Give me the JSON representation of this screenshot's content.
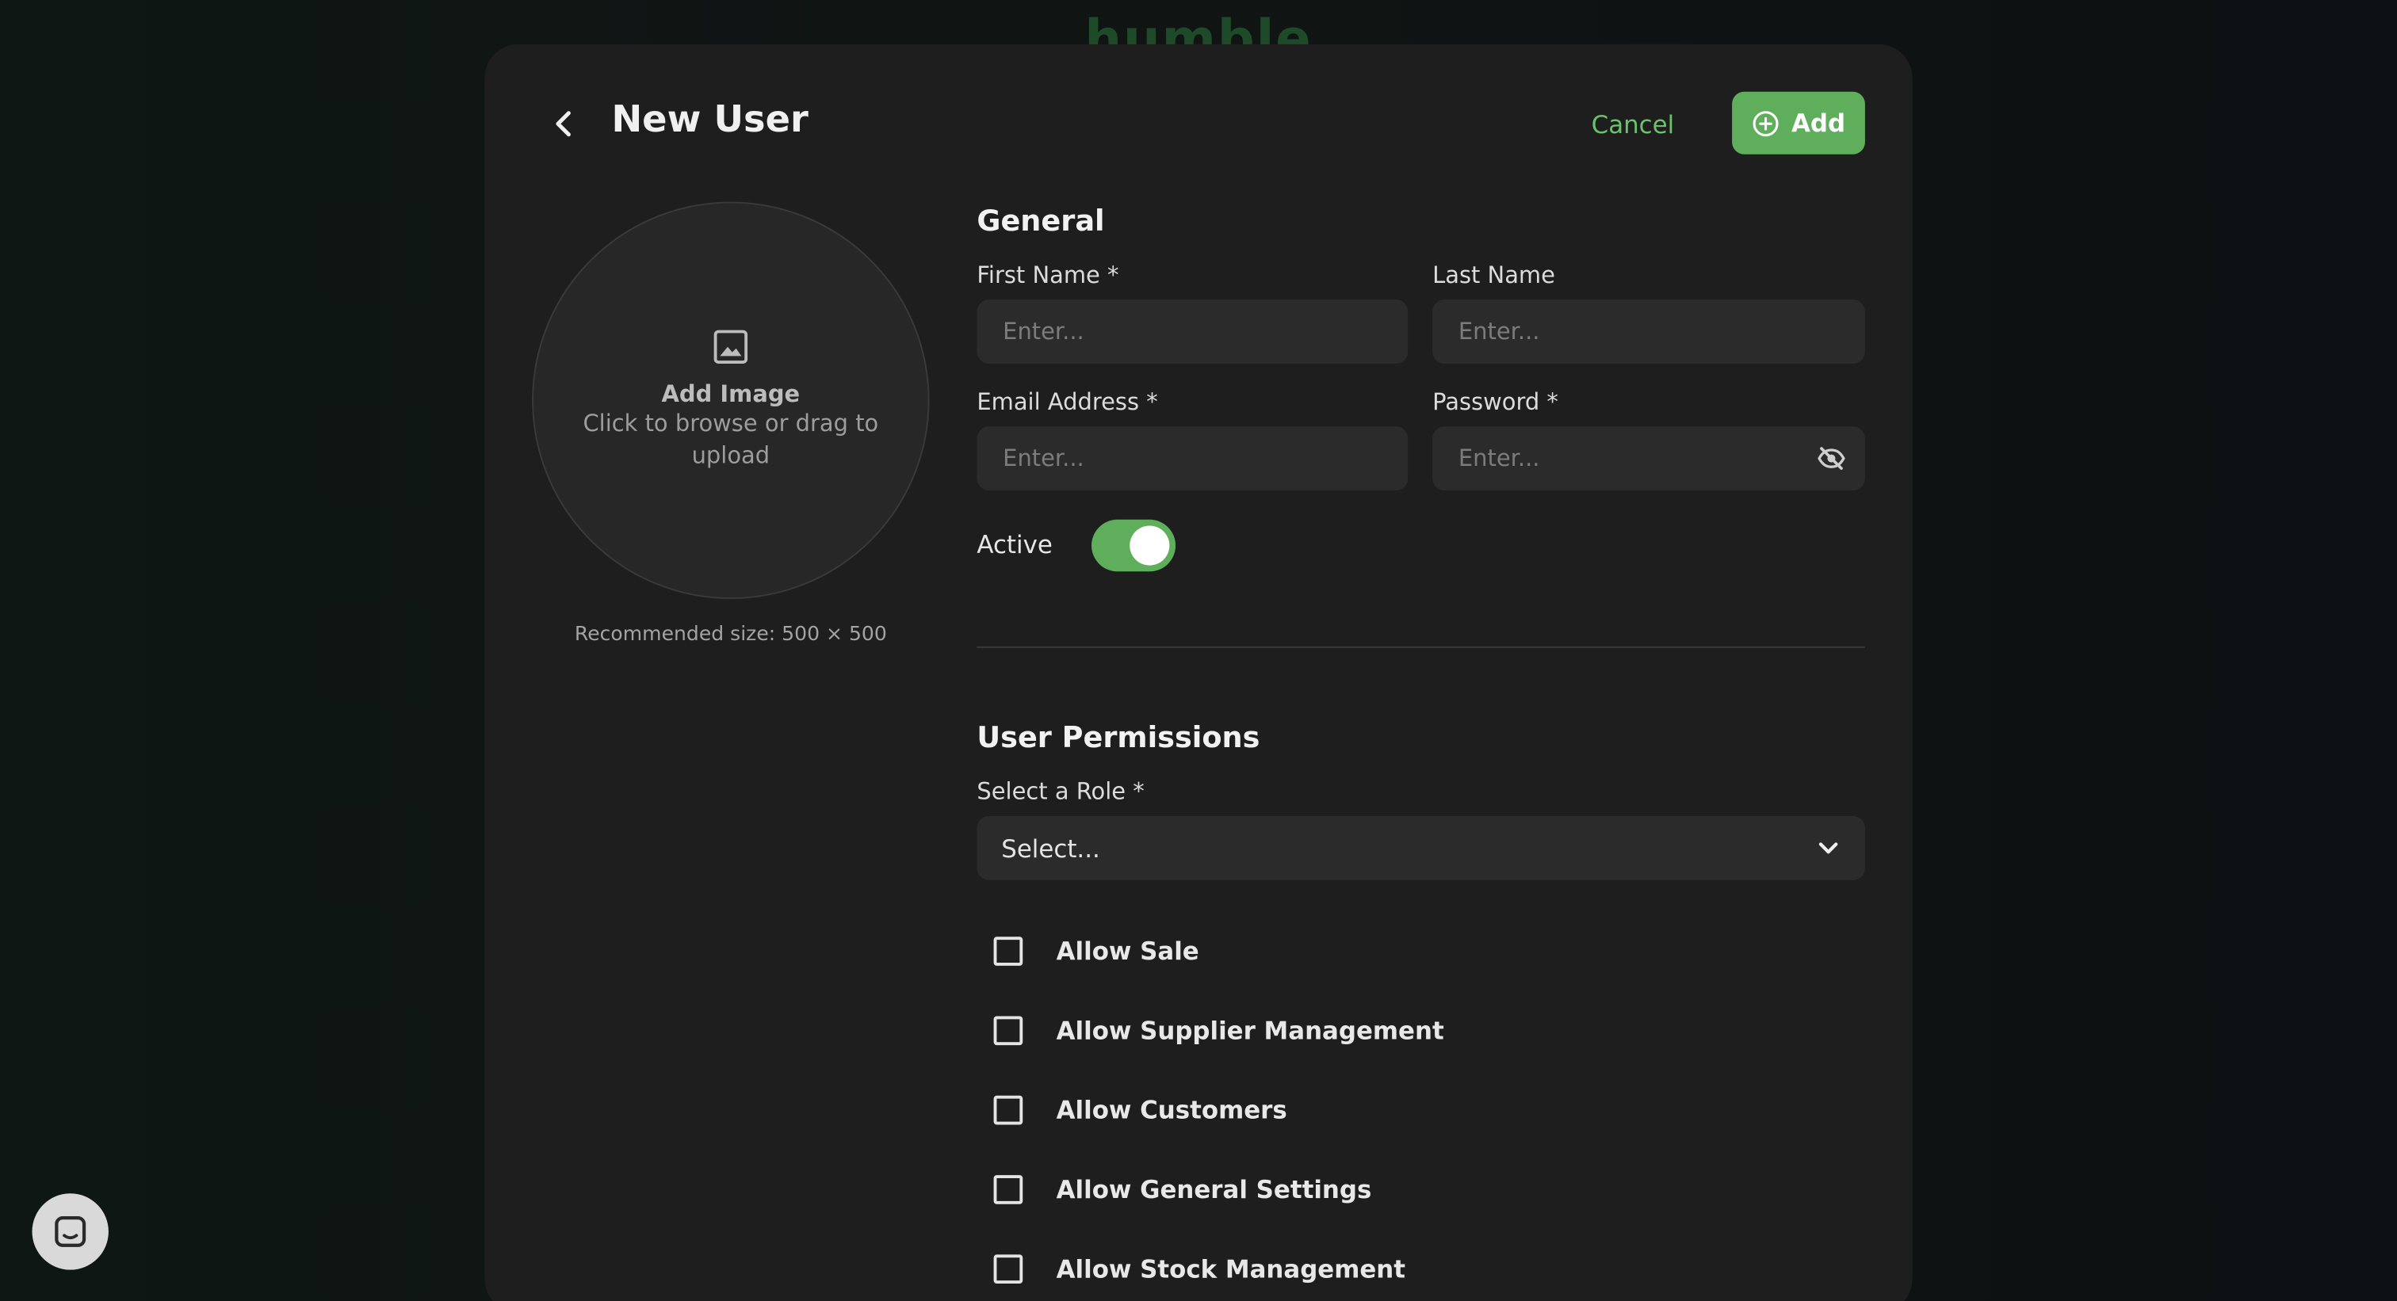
{
  "background": {
    "logo_text": "humble"
  },
  "header": {
    "title": "New User",
    "cancel_label": "Cancel",
    "add_label": "Add"
  },
  "image_upload": {
    "title": "Add Image",
    "subtitle": "Click to browse or drag to upload",
    "recommended": "Recommended size: 500 × 500"
  },
  "general": {
    "section_title": "General",
    "first_name": {
      "label": "First Name *",
      "placeholder": "Enter...",
      "value": ""
    },
    "last_name": {
      "label": "Last Name",
      "placeholder": "Enter...",
      "value": ""
    },
    "email": {
      "label": "Email Address *",
      "placeholder": "Enter...",
      "value": ""
    },
    "password": {
      "label": "Password *",
      "placeholder": "Enter...",
      "value": ""
    },
    "active_label": "Active",
    "active_on": true
  },
  "permissions": {
    "section_title": "User Permissions",
    "role_label": "Select a Role *",
    "role_value": "Select...",
    "items": [
      {
        "label": "Allow Sale",
        "checked": false
      },
      {
        "label": "Allow Supplier Management",
        "checked": false
      },
      {
        "label": "Allow Customers",
        "checked": false
      },
      {
        "label": "Allow General Settings",
        "checked": false
      },
      {
        "label": "Allow Stock Management",
        "checked": false
      }
    ]
  },
  "colors": {
    "accent": "#5fae5b",
    "accent_text": "#6ac26a",
    "modal_bg": "#1e1e1e",
    "input_bg": "#2b2b2b"
  },
  "icons": {
    "back": "chevron-left-icon",
    "add": "plus-circle-icon",
    "image": "image-icon",
    "password_toggle": "eye-off-icon",
    "select": "chevron-down-icon",
    "chat": "chat-icon"
  }
}
